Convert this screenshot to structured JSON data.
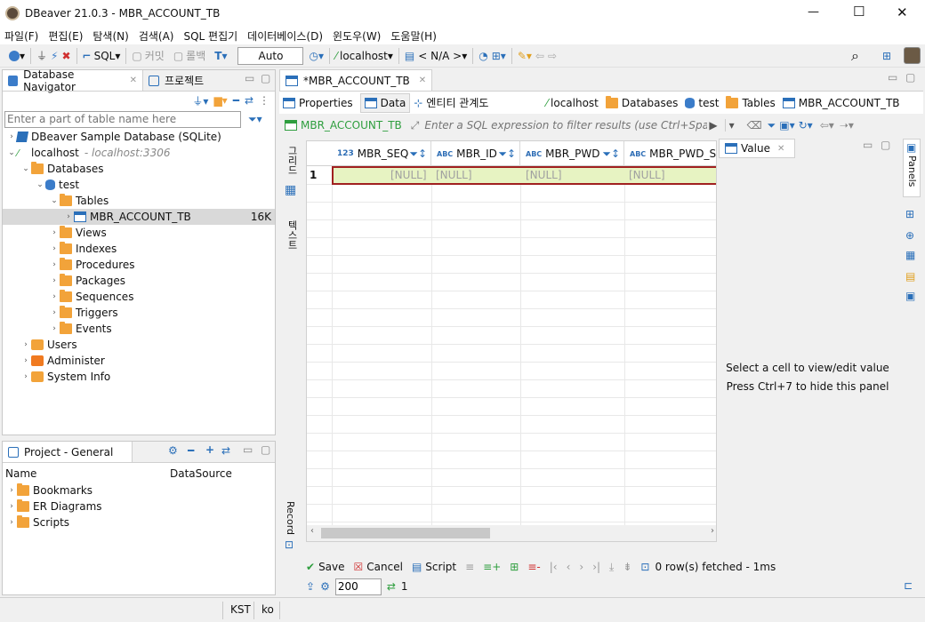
{
  "window": {
    "title": "DBeaver 21.0.3 - MBR_ACCOUNT_TB",
    "minimize": "—",
    "maximize": "☐",
    "close": "✕"
  },
  "menu": [
    "파일(F)",
    "편집(E)",
    "탐색(N)",
    "검색(A)",
    "SQL 편집기",
    "데이터베이스(D)",
    "윈도우(W)",
    "도움말(H)"
  ],
  "toolbar": {
    "sql": "SQL",
    "commit": "커밋",
    "rollback": "롤백",
    "tx_mode": "Auto",
    "connection": "localhost",
    "schema": "< N/A >"
  },
  "navigator": {
    "tab_label": "Database Navigator",
    "projects_tab": "프로젝트",
    "filter_placeholder": "Enter a part of table name here",
    "tree": [
      {
        "label": "DBeaver Sample Database (SQLite)",
        "indent": 0
      },
      {
        "label": "localhost",
        "sub": "- localhost:3306",
        "indent": 0
      },
      {
        "label": "Databases",
        "indent": 1
      },
      {
        "label": "test",
        "indent": 2
      },
      {
        "label": "Tables",
        "indent": 3
      },
      {
        "label": "MBR_ACCOUNT_TB",
        "size": "16K",
        "indent": 4
      },
      {
        "label": "Views",
        "indent": 3
      },
      {
        "label": "Indexes",
        "indent": 3
      },
      {
        "label": "Procedures",
        "indent": 3
      },
      {
        "label": "Packages",
        "indent": 3
      },
      {
        "label": "Sequences",
        "indent": 3
      },
      {
        "label": "Triggers",
        "indent": 3
      },
      {
        "label": "Events",
        "indent": 3
      },
      {
        "label": "Users",
        "indent": 1
      },
      {
        "label": "Administer",
        "indent": 1
      },
      {
        "label": "System Info",
        "indent": 1
      }
    ]
  },
  "project": {
    "tab_label": "Project - General",
    "col_name": "Name",
    "col_datasource": "DataSource",
    "items": [
      "Bookmarks",
      "ER Diagrams",
      "Scripts"
    ]
  },
  "editor": {
    "tab_label": "*MBR_ACCOUNT_TB",
    "subtabs": [
      "Properties",
      "Data",
      "엔티티 관계도"
    ],
    "breadcrumb": [
      "localhost",
      "Databases",
      "test",
      "Tables",
      "MBR_ACCOUNT_TB"
    ],
    "filter_table": "MBR_ACCOUNT_TB",
    "filter_placeholder": "Enter a SQL expression to filter results (use Ctrl+Space)",
    "vtab_grid": "그리드",
    "vtab_text": "텍스트",
    "vtab_record": "Record",
    "columns": [
      {
        "type": "123",
        "name": "MBR_SEQ"
      },
      {
        "type": "ABC",
        "name": "MBR_ID"
      },
      {
        "type": "ABC",
        "name": "MBR_PWD"
      },
      {
        "type": "ABC",
        "name": "MBR_PWD_SA"
      }
    ],
    "rows": [
      {
        "num": "1",
        "cells": [
          "[NULL]",
          "[NULL]",
          "[NULL]",
          "[NULL]"
        ]
      }
    ],
    "value_panel": {
      "title": "Value",
      "line1": "Select a cell to view/edit value",
      "line2": "Press Ctrl+7 to hide this panel",
      "panels_label": "Panels"
    },
    "actions": {
      "save": "Save",
      "cancel": "Cancel",
      "script": "Script",
      "fetched": "0 row(s) fetched - 1ms",
      "fetch_size": "200",
      "refresh_count": "1"
    }
  },
  "status": {
    "timezone": "KST",
    "locale": "ko"
  }
}
